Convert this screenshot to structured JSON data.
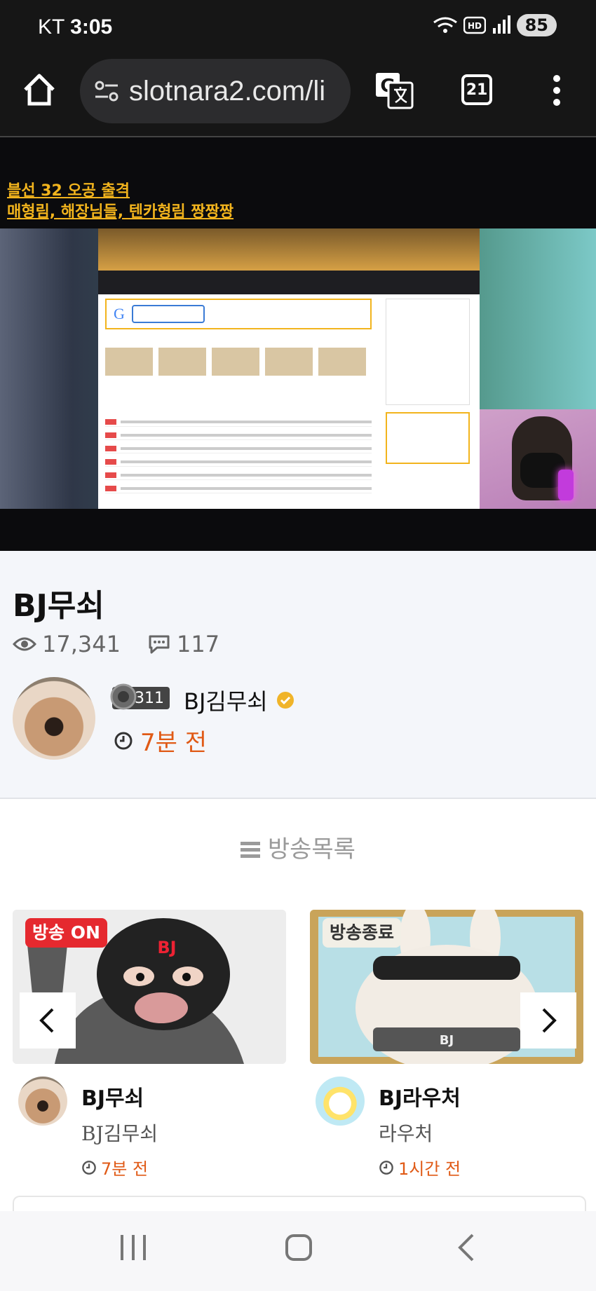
{
  "status_bar": {
    "carrier": "KT",
    "time": "3:05",
    "battery": "85"
  },
  "browser": {
    "url": "slotnara2.com/li",
    "tab_count": "21"
  },
  "video": {
    "caption_line1": "블선 32 오공 출격",
    "caption_line2": "매형림, 해장님들, 텐카형림 짱짱짱"
  },
  "post": {
    "title": "BJ무쇠",
    "views": "17,341",
    "comments": "117",
    "author": {
      "level": "311",
      "name": "BJ김무쇠",
      "time": "7분 전"
    }
  },
  "section_title": "방송목록",
  "broadcasts": [
    {
      "badge": "방송 ON",
      "name": "BJ무쇠",
      "sub": "BJ김무쇠",
      "time": "7분 전"
    },
    {
      "badge": "방송종료",
      "name": "BJ라우처",
      "sub": "라우처",
      "time": "1시간 전"
    }
  ],
  "colors": {
    "accent": "#e05a16",
    "live_badge": "#e5292f",
    "browser_bg": "#161616"
  }
}
